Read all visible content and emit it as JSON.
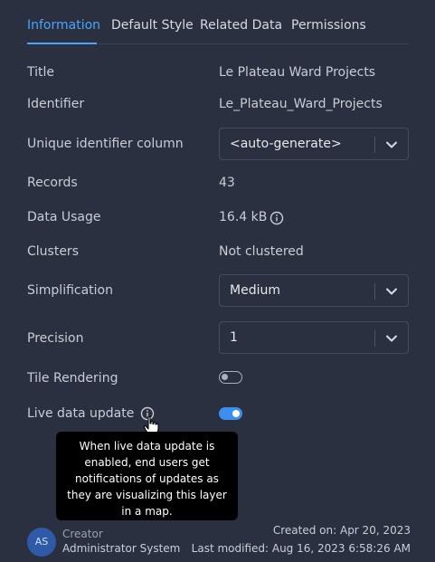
{
  "tabs": [
    {
      "label": "Information",
      "active": true
    },
    {
      "label": "Default Style",
      "active": false
    },
    {
      "label": "Related Data",
      "active": false
    },
    {
      "label": "Permissions",
      "active": false
    }
  ],
  "fields": {
    "title": {
      "label": "Title",
      "value": "Le Plateau Ward Projects"
    },
    "identifier": {
      "label": "Identifier",
      "value": "Le_Plateau_Ward_Projects"
    },
    "unique_id_column": {
      "label": "Unique identifier column",
      "value": "<auto-generate>"
    },
    "records": {
      "label": "Records",
      "value": "43"
    },
    "data_usage": {
      "label": "Data Usage",
      "value": "16.4 kB"
    },
    "clusters": {
      "label": "Clusters",
      "value": "Not clustered"
    },
    "simplification": {
      "label": "Simplification",
      "value": "Medium"
    },
    "precision": {
      "label": "Precision",
      "value": "1"
    },
    "tile_rendering": {
      "label": "Tile Rendering",
      "enabled": false
    },
    "live_data_update": {
      "label": "Live data update",
      "enabled": true
    }
  },
  "tooltip": {
    "text": "When live data update is enabled, end users get notifications of updates as they are visualizing this layer in a map."
  },
  "footer": {
    "avatar_initials": "AS",
    "creator_label": "Creator",
    "creator_name": "Administrator System",
    "created_on": "Created on: Apr 20, 2023",
    "last_modified": "Last modified: Aug 16, 2023 6:58:26 AM"
  },
  "colors": {
    "background": "#2b3040",
    "accent": "#4aa3ff",
    "toggle_on": "#3d8ef0",
    "tooltip_bg": "#000000"
  }
}
